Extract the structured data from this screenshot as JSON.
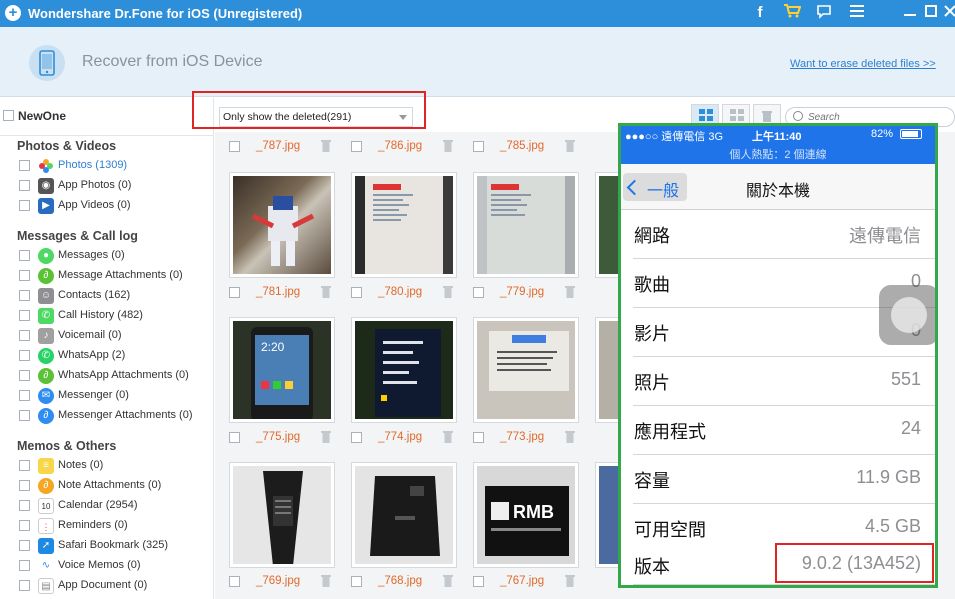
{
  "window": {
    "title": "Wondershare Dr.Fone for iOS (Unregistered)"
  },
  "header": {
    "title": "Recover from iOS Device",
    "erase_link": "Want to erase deleted files >>"
  },
  "sidebar": {
    "device": "NewOne",
    "sections": [
      {
        "title": "Photos & Videos",
        "items": [
          {
            "label": "Photos (1309)",
            "icon": "photos-icon",
            "color": "#f5a623",
            "active": true
          },
          {
            "label": "App Photos (0)",
            "icon": "camera-icon",
            "color": "#555555"
          },
          {
            "label": "App Videos (0)",
            "icon": "clapper-icon",
            "color": "#2a6bc2"
          }
        ]
      },
      {
        "title": "Messages & Call log",
        "items": [
          {
            "label": "Messages (0)",
            "icon": "message-icon",
            "color": "#4cd964"
          },
          {
            "label": "Message Attachments (0)",
            "icon": "paperclip-icon",
            "color": "#5bc236"
          },
          {
            "label": "Contacts (162)",
            "icon": "contacts-icon",
            "color": "#8e8e93"
          },
          {
            "label": "Call History (482)",
            "icon": "phone-icon",
            "color": "#4cd964"
          },
          {
            "label": "Voicemail (0)",
            "icon": "voicemail-icon",
            "color": "#a0a0a0"
          },
          {
            "label": "WhatsApp (2)",
            "icon": "whatsapp-icon",
            "color": "#25d366"
          },
          {
            "label": "WhatsApp Attachments (0)",
            "icon": "paperclip-icon",
            "color": "#5bc236"
          },
          {
            "label": "Messenger (0)",
            "icon": "messenger-icon",
            "color": "#2f8cf0"
          },
          {
            "label": "Messenger Attachments (0)",
            "icon": "paperclip-icon",
            "color": "#2f8cf0"
          }
        ]
      },
      {
        "title": "Memos & Others",
        "items": [
          {
            "label": "Notes (0)",
            "icon": "notes-icon",
            "color": "#f7d64a"
          },
          {
            "label": "Note Attachments (0)",
            "icon": "paperclip-icon",
            "color": "#f5a623"
          },
          {
            "label": "Calendar (2954)",
            "icon": "calendar-icon",
            "color": "#e8e8e8"
          },
          {
            "label": "Reminders (0)",
            "icon": "reminders-icon",
            "color": "#e0e0e0"
          },
          {
            "label": "Safari Bookmark (325)",
            "icon": "safari-icon",
            "color": "#1e88e5"
          },
          {
            "label": "Voice Memos (0)",
            "icon": "voice-memo-icon",
            "color": "#e0e0e0"
          },
          {
            "label": "App Document (0)",
            "icon": "document-icon",
            "color": "#e0e0e0"
          }
        ]
      }
    ]
  },
  "toolbar": {
    "filter_value": "Only show the deleted(291)",
    "search_placeholder": "Search"
  },
  "grid": {
    "rows": [
      {
        "files": [
          "_787.jpg",
          "_786.jpg",
          "_785.jpg"
        ]
      },
      {
        "files": [
          "_781.jpg",
          "_780.jpg",
          "_779.jpg"
        ]
      },
      {
        "files": [
          "_775.jpg",
          "_774.jpg",
          "_773.jpg"
        ]
      },
      {
        "files": [
          "_769.jpg",
          "_768.jpg",
          "_767.jpg"
        ]
      }
    ]
  },
  "phone": {
    "carrier": "●●●○○ 遠傳電信 3G",
    "time": "上午11:40",
    "battery": "82%",
    "hotspot": "個人熱點：2 個連線",
    "back_label": "一般",
    "title": "關於本機",
    "rows": [
      {
        "key": "網路",
        "value": "遠傳電信"
      },
      {
        "key": "歌曲",
        "value": "0"
      },
      {
        "key": "影片",
        "value": "0"
      },
      {
        "key": "照片",
        "value": "551"
      },
      {
        "key": "應用程式",
        "value": "24"
      },
      {
        "key": "容量",
        "value": "11.9 GB"
      },
      {
        "key": "可用空間",
        "value": "4.5 GB"
      },
      {
        "key": "版本",
        "value": "9.0.2 (13A452)"
      }
    ]
  }
}
